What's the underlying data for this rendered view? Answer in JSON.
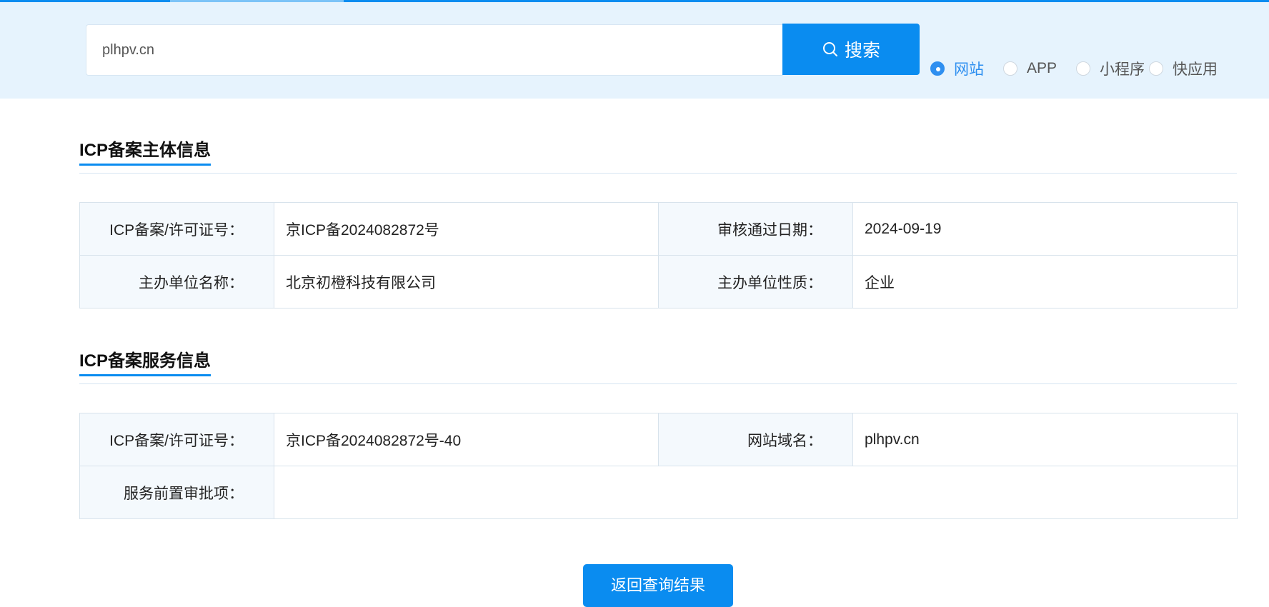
{
  "search": {
    "value": "plhpv.cn",
    "button_label": "搜索"
  },
  "filters": [
    {
      "label": "网站",
      "checked": true
    },
    {
      "label": "APP",
      "checked": false
    },
    {
      "label": "小程序",
      "checked": false
    },
    {
      "label": "快应用",
      "checked": false
    }
  ],
  "subject_info": {
    "title": "ICP备案主体信息",
    "rows": [
      {
        "label1": "ICP备案/许可证号：",
        "value1": "京ICP备2024082872号",
        "label2": "审核通过日期：",
        "value2": "2024-09-19"
      },
      {
        "label1": "主办单位名称：",
        "value1": "北京初橙科技有限公司",
        "label2": "主办单位性质：",
        "value2": "企业"
      }
    ]
  },
  "service_info": {
    "title": "ICP备案服务信息",
    "rows": [
      {
        "label1": "ICP备案/许可证号：",
        "value1": "京ICP备2024082872号-40",
        "label2": "网站域名：",
        "value2": "plhpv.cn"
      },
      {
        "label1": "服务前置审批项：",
        "value1": ""
      }
    ]
  },
  "back_button_label": "返回查询结果",
  "colors": {
    "accent": "#0a8cf0",
    "band": "#e6f3fd",
    "label_bg": "#f4f9fd"
  }
}
